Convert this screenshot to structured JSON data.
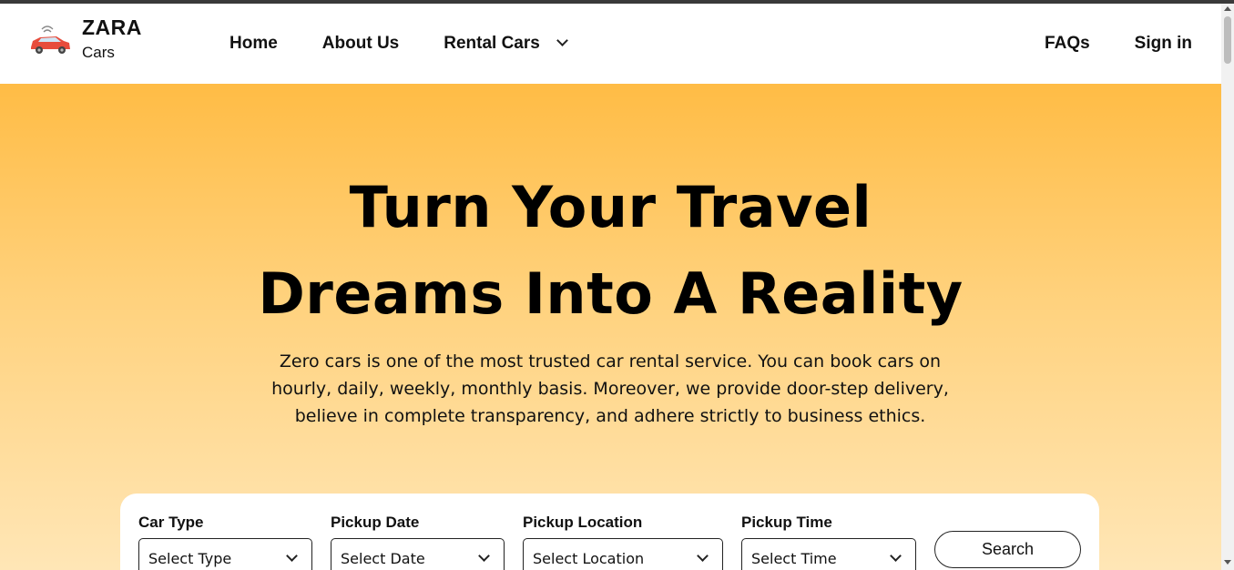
{
  "brand": {
    "name": "ZARA",
    "sub": "Cars",
    "logo_icon": "car-icon"
  },
  "nav": {
    "left": [
      "Home",
      "About Us",
      "Rental Cars"
    ],
    "right": [
      "FAQs",
      "Sign in"
    ]
  },
  "hero": {
    "title_line1": "Turn Your Travel",
    "title_line2": "Dreams Into A Reality",
    "description_line1": "Zero cars is one of the most trusted car rental service. You can book cars on",
    "description_line2": "hourly, daily, weekly, monthly basis. Moreover, we provide door-step delivery,",
    "description_line3": "believe in complete transparency, and adhere strictly to business ethics."
  },
  "search": {
    "fields": [
      {
        "label": "Car Type",
        "value": "Select Type"
      },
      {
        "label": "Pickup Date",
        "value": "Select Date"
      },
      {
        "label": "Pickup Location",
        "value": "Select Location"
      },
      {
        "label": "Pickup Time",
        "value": "Select Time"
      }
    ],
    "button": "Search"
  },
  "colors": {
    "hero_top": "#ffbc45",
    "hero_bottom": "#ffe6b6",
    "logo_car": "#e74c3c"
  }
}
